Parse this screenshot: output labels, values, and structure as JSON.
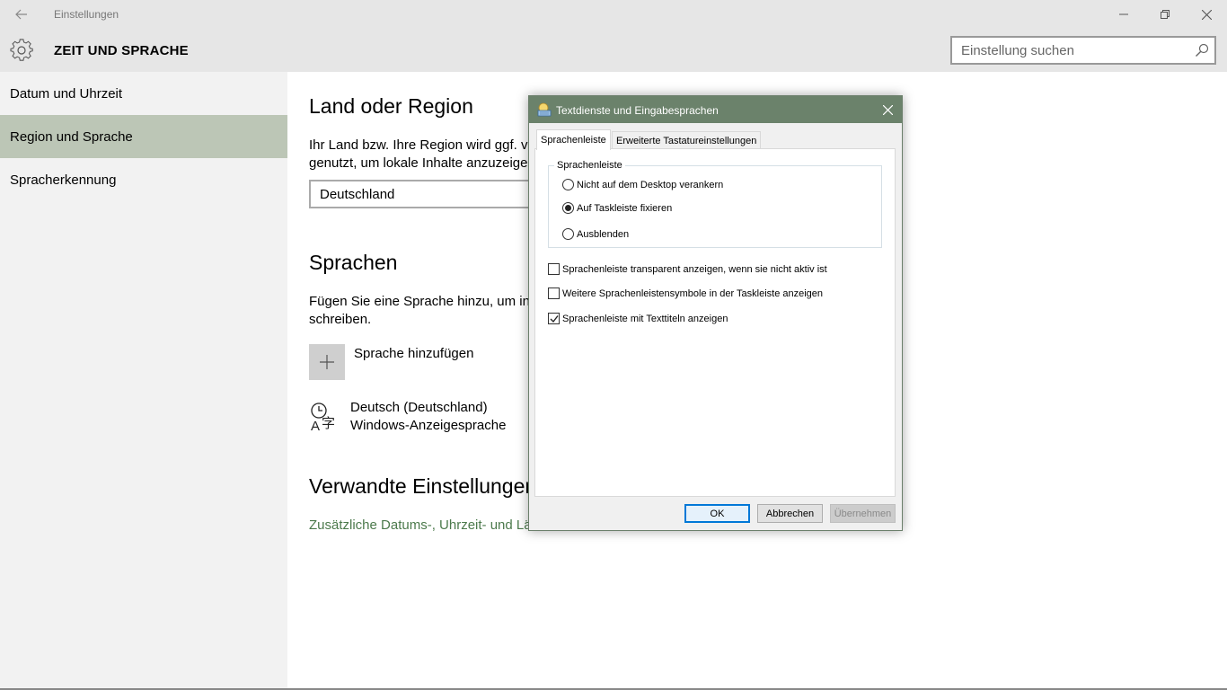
{
  "window": {
    "app_title": "Einstellungen",
    "back_icon": "arrow-left-icon",
    "minimize_icon": "minimize-icon",
    "maximize_icon": "restore-icon",
    "close_icon": "close-icon"
  },
  "header": {
    "title": "ZEIT UND SPRACHE",
    "icon": "gear-icon",
    "search_placeholder": "Einstellung suchen"
  },
  "sidebar": {
    "items": [
      {
        "label": "Datum und Uhrzeit",
        "active": false
      },
      {
        "label": "Region und Sprache",
        "active": true
      },
      {
        "label": "Spracherkennung",
        "active": false
      }
    ]
  },
  "main": {
    "region_heading": "Land oder Region",
    "region_desc_line1": "Ihr Land bzw. Ihre Region wird ggf. vo",
    "region_desc_line2": "genutzt, um lokale Inhalte anzuzeigen",
    "country_value": "Deutschland",
    "languages_heading": "Sprachen",
    "languages_desc_line1": "Fügen Sie eine Sprache hinzu, um in d",
    "languages_desc_line2": "schreiben.",
    "add_language_label": "Sprache hinzufügen",
    "language_name": "Deutsch (Deutschland)",
    "language_sub": "Windows-Anzeigesprache",
    "related_heading": "Verwandte Einstellungen",
    "related_link": "Zusätzliche Datums-, Uhrzeit- und Lä"
  },
  "dialog": {
    "title": "Textdienste und Eingabesprachen",
    "tabs": [
      "Sprachenleiste",
      "Erweiterte Tastatureinstellungen"
    ],
    "group_label": "Sprachenleiste",
    "radios": [
      {
        "label": "Nicht auf dem Desktop verankern",
        "checked": false
      },
      {
        "label": "Auf Taskleiste fixieren",
        "checked": true
      },
      {
        "label": "Ausblenden",
        "checked": false
      }
    ],
    "checkboxes": [
      {
        "label": "Sprachenleiste transparent anzeigen, wenn sie nicht aktiv ist",
        "checked": false
      },
      {
        "label": "Weitere Sprachenleistensymbole in der Taskleiste anzeigen",
        "checked": false
      },
      {
        "label": "Sprachenleiste mit Texttiteln anzeigen",
        "checked": true
      }
    ],
    "buttons": {
      "ok": "OK",
      "cancel": "Abbrechen",
      "apply": "Übernehmen"
    }
  },
  "colors": {
    "accent": "#6b826b",
    "sidebar_active": "#bcc6b6",
    "link": "#4c7a4c"
  }
}
